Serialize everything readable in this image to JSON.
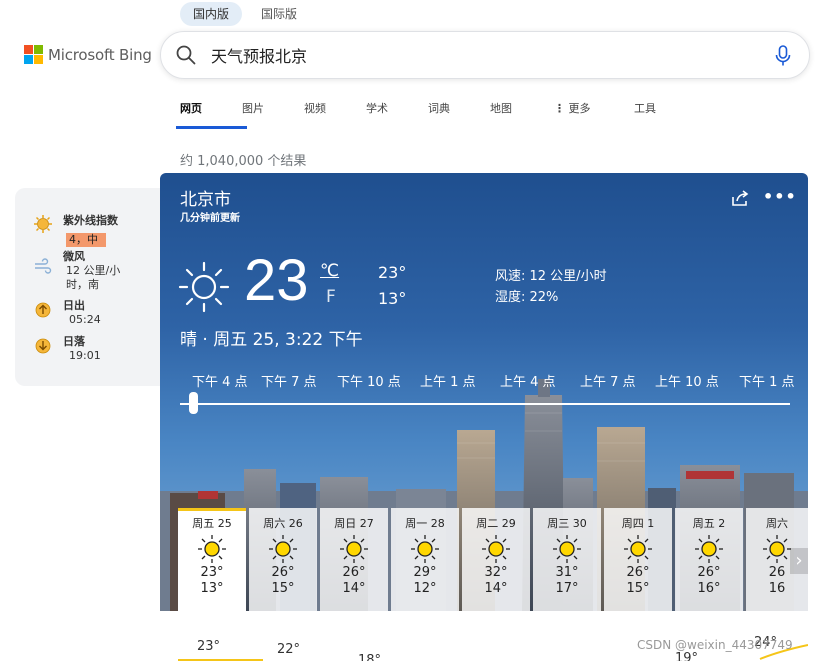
{
  "region_tabs": [
    "国内版",
    "国际版"
  ],
  "logo": {
    "text": "Microsoft Bing",
    "colors": [
      "#f25022",
      "#7fba00",
      "#00a4ef",
      "#ffb900"
    ]
  },
  "search": {
    "value": "天气预报北京",
    "icon": "search-icon",
    "mic_icon": "microphone-icon"
  },
  "nav": [
    "网页",
    "图片",
    "视频",
    "学术",
    "词典",
    "地图",
    "更多",
    "工具"
  ],
  "result_count": "约 1,040,000 个结果",
  "side": {
    "uv_label": "紫外线指数",
    "uv_value": "4，中",
    "wind_label": "微风",
    "wind_value_1": "12 公里/小",
    "wind_value_2": "时，南",
    "sunrise_label": "日出",
    "sunrise_value": "05:24",
    "sunset_label": "日落",
    "sunset_value": "19:01"
  },
  "weather": {
    "city": "北京市",
    "updated": "几分钟前更新",
    "temp": "23",
    "unit_c": "℃",
    "unit_f": "F",
    "high": "23°",
    "low": "13°",
    "wind": "风速: 12 公里/小时",
    "humidity": "湿度: 22%",
    "desc": "晴 · 周五 25, 3:22 下午",
    "hours": [
      "下午 4 点",
      "下午 7 点",
      "下午 10 点",
      "上午 1 点",
      "上午 4 点",
      "上午 7 点",
      "上午 10 点",
      "下午 1 点"
    ],
    "days": [
      {
        "name": "周五 25",
        "hi": "23°",
        "lo": "13°"
      },
      {
        "name": "周六 26",
        "hi": "26°",
        "lo": "15°"
      },
      {
        "name": "周日 27",
        "hi": "26°",
        "lo": "14°"
      },
      {
        "name": "周一 28",
        "hi": "29°",
        "lo": "12°"
      },
      {
        "name": "周二 29",
        "hi": "32°",
        "lo": "14°"
      },
      {
        "name": "周三 30",
        "hi": "31°",
        "lo": "17°"
      },
      {
        "name": "周四 1",
        "hi": "26°",
        "lo": "15°"
      },
      {
        "name": "周五 2",
        "hi": "26°",
        "lo": "16°"
      },
      {
        "name": "周六",
        "hi": "26",
        "lo": "16"
      }
    ],
    "graph_labels": [
      "23°",
      "22°",
      "18°",
      "19°",
      "24°"
    ],
    "accent": "#f5c518"
  },
  "watermark": "CSDN @weixin_44307749"
}
